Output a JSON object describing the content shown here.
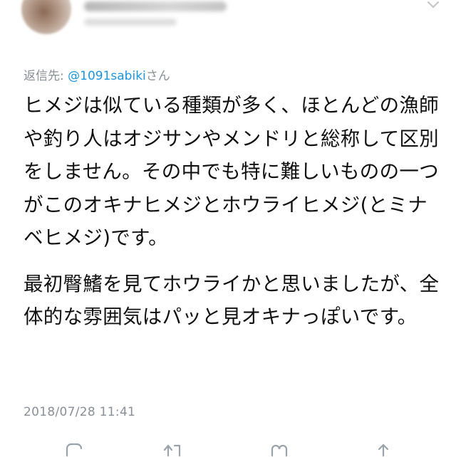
{
  "tweet": {
    "reply_label": "返信先: ",
    "reply_mention": "@1091sabiki",
    "reply_suffix": "さん",
    "body_paragraph_1": "ヒメジは似ている種類が多く、ほとんどの漁師や釣り人はオジサンやメンドリと総称して区別をしません。その中でも特に難しいものの一つがこのオキナヒメジとホウライヒメジ(とミナベヒメジ)です。",
    "body_paragraph_2": "最初臀鰭を見てホウライかと思いましたが、全体的な雰囲気はパッと見オキナっぽいです。",
    "timestamp": "2018/07/28 11:41"
  },
  "icons": {
    "more": "chevron-down-icon",
    "reply": "reply-icon",
    "retweet": "retweet-icon",
    "like": "heart-icon",
    "share": "share-icon"
  },
  "colors": {
    "link": "#1b95e0",
    "muted": "#8a9097",
    "text": "#111111"
  }
}
